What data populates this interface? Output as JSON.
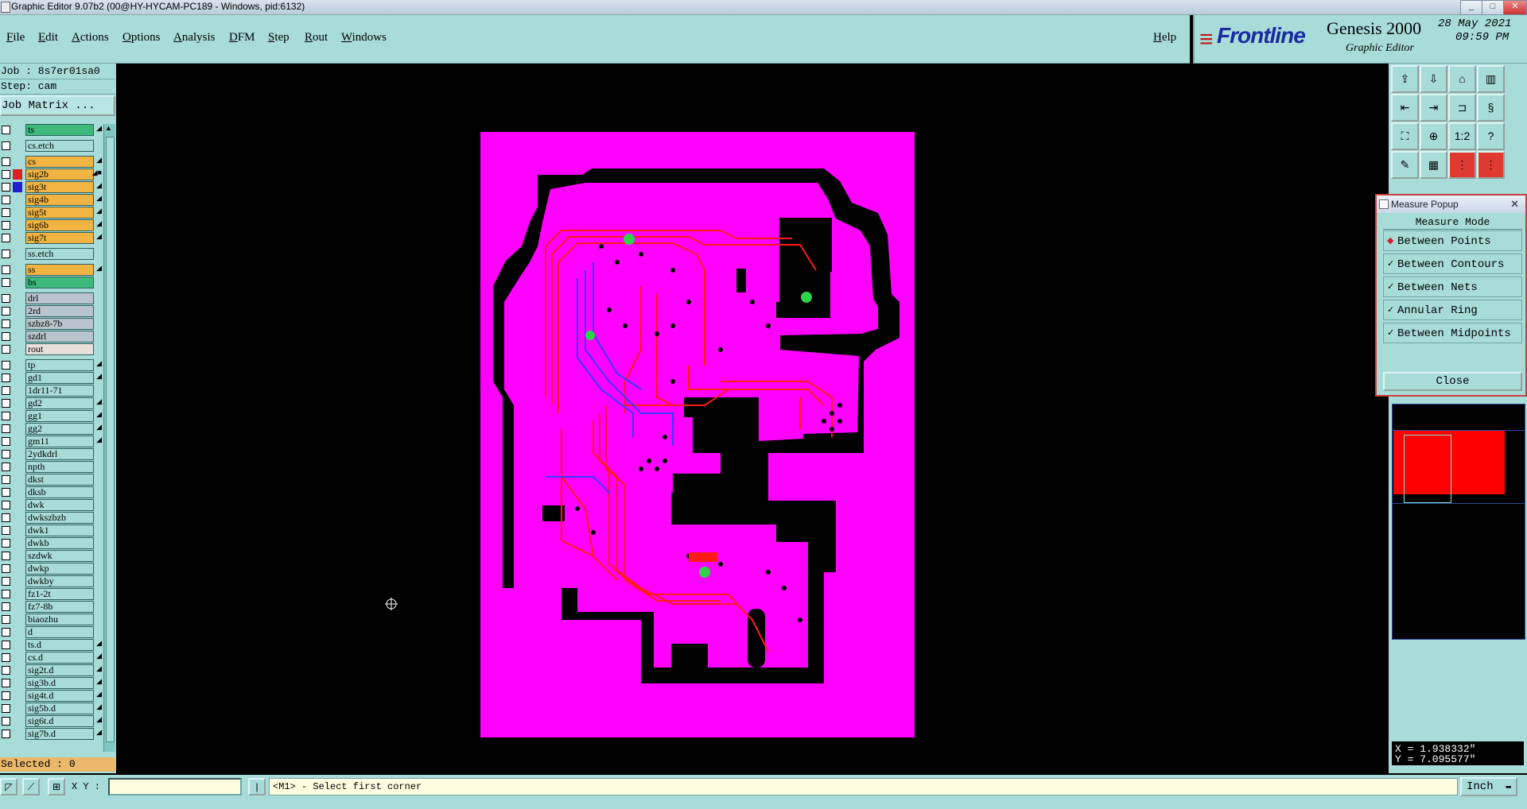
{
  "window": {
    "title": "Graphic Editor 9.07b2 (00@HY-HYCAM-PC189 - Windows, pid:6132)",
    "btn_min": "_",
    "btn_max": "□",
    "btn_close": "✕"
  },
  "menu": {
    "items": [
      "File",
      "Edit",
      "Actions",
      "Options",
      "Analysis",
      "DFM",
      "Step",
      "Rout",
      "Windows"
    ],
    "help": "Help"
  },
  "brand": {
    "logo": "Frontline",
    "product": "Genesis 2000",
    "subtitle": "Graphic Editor",
    "date": "28 May 2021",
    "time": "09:59 PM"
  },
  "left": {
    "job": "Job : 8s7er01sa0",
    "step": "Step: cam",
    "job_matrix": "Job Matrix ...",
    "selected": "Selected : 0"
  },
  "layers": [
    {
      "name": "ts",
      "color": "#3fb87c",
      "flag": "◢",
      "group": 0
    },
    {
      "name": "cs.etch",
      "color": "#a8dcd9",
      "flag": "",
      "group": 1
    },
    {
      "name": "cs",
      "color": "#f2b441",
      "flag": "◢",
      "group": 2
    },
    {
      "name": "sig2b",
      "color": "#f2b441",
      "flag": "◢■",
      "group": 2,
      "swatch": "#e02020"
    },
    {
      "name": "sig3t",
      "color": "#f2b441",
      "flag": "◢",
      "group": 2,
      "swatch": "#2020d0"
    },
    {
      "name": "sig4b",
      "color": "#f2b441",
      "flag": "◢",
      "group": 2
    },
    {
      "name": "sig5t",
      "color": "#f2b441",
      "flag": "◢",
      "group": 2
    },
    {
      "name": "sig6b",
      "color": "#f2b441",
      "flag": "◢",
      "group": 2
    },
    {
      "name": "sig7t",
      "color": "#f2b441",
      "flag": "◢",
      "group": 2
    },
    {
      "name": "ss.etch",
      "color": "#a8dcd9",
      "flag": "",
      "group": 3
    },
    {
      "name": "ss",
      "color": "#f2b441",
      "flag": "◢",
      "group": 4
    },
    {
      "name": "bs",
      "color": "#3fb87c",
      "flag": "",
      "group": 4
    },
    {
      "name": "drl",
      "color": "#b9c4cc",
      "flag": "",
      "group": 5
    },
    {
      "name": "2rd",
      "color": "#b9c4cc",
      "flag": "",
      "group": 5
    },
    {
      "name": "szbz8-7b",
      "color": "#b9c4cc",
      "flag": "",
      "group": 5
    },
    {
      "name": "szdrl",
      "color": "#b9c4cc",
      "flag": "",
      "group": 5
    },
    {
      "name": "rout",
      "color": "#e8e0d8",
      "flag": "",
      "group": 5
    },
    {
      "name": "tp",
      "color": "#a8dcd9",
      "flag": "◢",
      "group": 6
    },
    {
      "name": "gd1",
      "color": "#a8dcd9",
      "flag": "◢",
      "group": 6
    },
    {
      "name": "1dr11-71",
      "color": "#a8dcd9",
      "flag": "",
      "group": 6
    },
    {
      "name": "gd2",
      "color": "#a8dcd9",
      "flag": "◢",
      "group": 6
    },
    {
      "name": "gg1",
      "color": "#a8dcd9",
      "flag": "◢",
      "group": 6
    },
    {
      "name": "gg2",
      "color": "#a8dcd9",
      "flag": "◢",
      "group": 6
    },
    {
      "name": "gm11",
      "color": "#a8dcd9",
      "flag": "◢",
      "group": 6
    },
    {
      "name": "2ydkdrl",
      "color": "#a8dcd9",
      "flag": "",
      "group": 6
    },
    {
      "name": "npth",
      "color": "#a8dcd9",
      "flag": "",
      "group": 6
    },
    {
      "name": "dkst",
      "color": "#a8dcd9",
      "flag": "",
      "group": 6
    },
    {
      "name": "dksb",
      "color": "#a8dcd9",
      "flag": "",
      "group": 6
    },
    {
      "name": "dwk",
      "color": "#a8dcd9",
      "flag": "",
      "group": 6
    },
    {
      "name": "dwkszbzb",
      "color": "#a8dcd9",
      "flag": "",
      "group": 6
    },
    {
      "name": "dwk1",
      "color": "#a8dcd9",
      "flag": "",
      "group": 6
    },
    {
      "name": "dwkb",
      "color": "#a8dcd9",
      "flag": "",
      "group": 6
    },
    {
      "name": "szdwk",
      "color": "#a8dcd9",
      "flag": "",
      "group": 6
    },
    {
      "name": "dwkp",
      "color": "#a8dcd9",
      "flag": "",
      "group": 6
    },
    {
      "name": "dwkby",
      "color": "#a8dcd9",
      "flag": "",
      "group": 6
    },
    {
      "name": "fz1-2t",
      "color": "#a8dcd9",
      "flag": "",
      "group": 6
    },
    {
      "name": "fz7-8b",
      "color": "#a8dcd9",
      "flag": "",
      "group": 6
    },
    {
      "name": "biaozhu",
      "color": "#a8dcd9",
      "flag": "",
      "group": 6
    },
    {
      "name": "d",
      "color": "#a8dcd9",
      "flag": "",
      "group": 6
    },
    {
      "name": "ts.d",
      "color": "#a8dcd9",
      "flag": "◢",
      "group": 6
    },
    {
      "name": "cs.d",
      "color": "#a8dcd9",
      "flag": "◢",
      "group": 6
    },
    {
      "name": "sig2t.d",
      "color": "#a8dcd9",
      "flag": "◢",
      "group": 6
    },
    {
      "name": "sig3b.d",
      "color": "#a8dcd9",
      "flag": "◢",
      "group": 6
    },
    {
      "name": "sig4t.d",
      "color": "#a8dcd9",
      "flag": "◢",
      "group": 6
    },
    {
      "name": "sig5b.d",
      "color": "#a8dcd9",
      "flag": "◢",
      "group": 6
    },
    {
      "name": "sig6t.d",
      "color": "#a8dcd9",
      "flag": "◢",
      "group": 6
    },
    {
      "name": "sig7b.d",
      "color": "#a8dcd9",
      "flag": "◢",
      "group": 6
    }
  ],
  "toolbar": {
    "ratio_label": "1:2",
    "help_label": "?"
  },
  "measure": {
    "title": "Measure Popup",
    "mode_title": "Measure Mode",
    "options": [
      {
        "label": "Between Points",
        "selected": true
      },
      {
        "label": "Between Contours",
        "selected": false
      },
      {
        "label": "Between Nets",
        "selected": false
      },
      {
        "label": "Annular Ring",
        "selected": false
      },
      {
        "label": "Between Midpoints",
        "selected": false
      }
    ],
    "close": "Close"
  },
  "coords": {
    "x": "X = 1.938332\"",
    "y": "Y = 7.095577\""
  },
  "status": {
    "xy_label": "X Y :",
    "xy_value": "",
    "prompt": "<M1> - Select first corner",
    "units": "Inch"
  },
  "colors": {
    "panel": "#a8dcd9",
    "board": "#ff00ff",
    "trace_red": "#ff1a1a",
    "trace_blue": "#3a3aff",
    "pad_green": "#2fd24a"
  }
}
